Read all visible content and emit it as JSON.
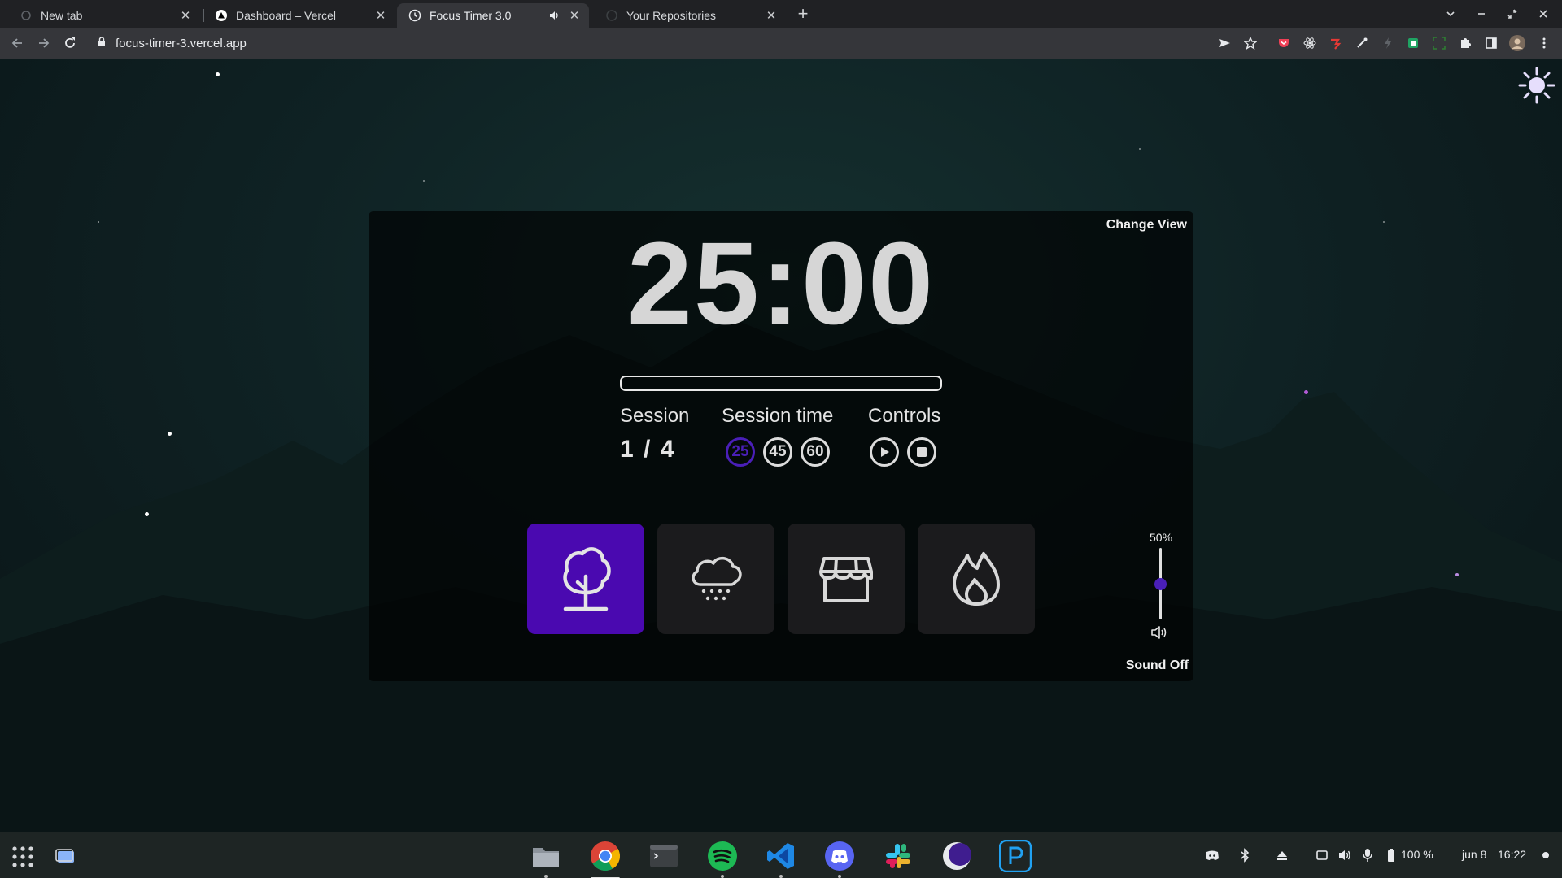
{
  "browser": {
    "tabs": [
      {
        "title": "New tab",
        "active": false
      },
      {
        "title": "Dashboard – Vercel",
        "active": false
      },
      {
        "title": "Focus Timer 3.0",
        "active": true,
        "audio": true
      },
      {
        "title": "Your Repositories",
        "active": false
      }
    ],
    "url": "focus-timer-3.vercel.app"
  },
  "timer": {
    "change_view_label": "Change View",
    "time": "25:00",
    "progress": 0,
    "session_label": "Session",
    "session_count": "1 / 4",
    "session_time_label": "Session time",
    "presets": [
      "25",
      "45",
      "60"
    ],
    "selected_preset": "25",
    "controls_label": "Controls"
  },
  "sounds": {
    "cards": [
      {
        "icon": "tree-icon",
        "active": true
      },
      {
        "icon": "cloud-rain-icon",
        "active": false
      },
      {
        "icon": "storefront-icon",
        "active": false
      },
      {
        "icon": "fire-icon",
        "active": false
      }
    ],
    "volume_label": "50%",
    "volume": 0.5,
    "sound_toggle_label": "Sound Off"
  },
  "shelf": {
    "apps": [
      "files",
      "chrome",
      "terminal",
      "spotify",
      "vscode",
      "discord",
      "slack",
      "eclipse",
      "pycharm"
    ],
    "battery": "100 %",
    "date": "jun 8",
    "time": "16:22"
  },
  "colors": {
    "accent": "#4a09b0",
    "accent_text": "#4a1fb8",
    "card_bg": "#1b1b1d",
    "chrome_bg": "#202124"
  }
}
